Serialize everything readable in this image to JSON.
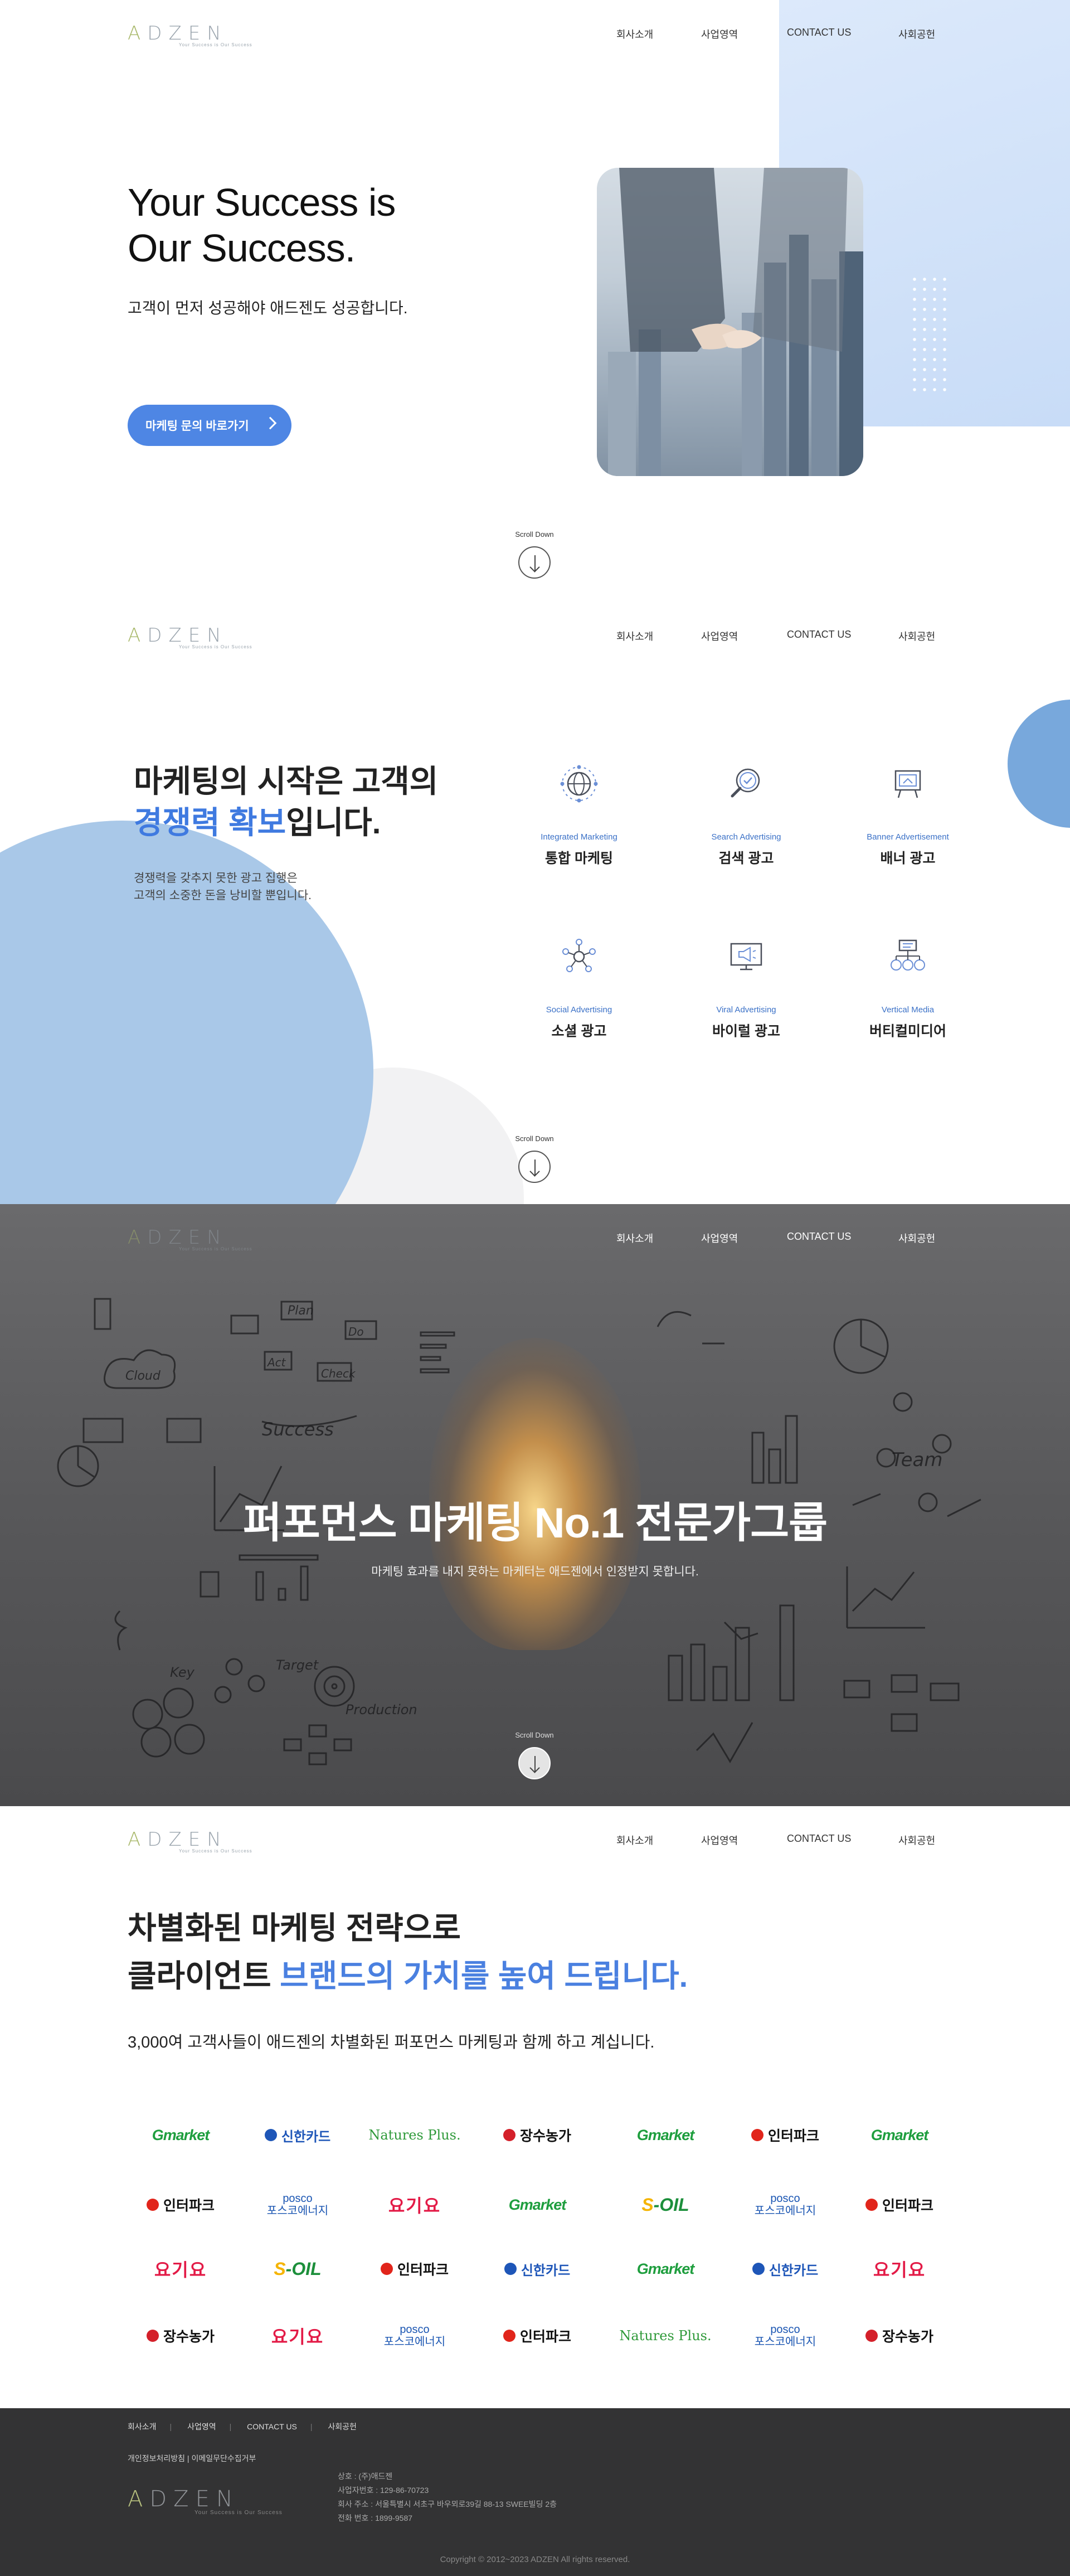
{
  "brand": {
    "logo": "ADZEN",
    "tagline": "Your Success is Our Success"
  },
  "nav": {
    "about": "회사소개",
    "business": "사업영역",
    "contact": "CONTACT US",
    "csr": "사회공헌"
  },
  "hero": {
    "title_line1": "Your Success is",
    "title_line2": "Our Success.",
    "subtitle": "고객이 먼저 성공해야 애드젠도 성공합니다.",
    "cta_label": "마케팅 문의 바로가기",
    "scroll_label": "Scroll Down"
  },
  "intro": {
    "title_line1": "마케팅의 시작은 고객의",
    "title_highlight": "경쟁력 확보",
    "title_suffix": "입니다.",
    "desc_line1": "경쟁력을 갖추지 못한 광고 집행은",
    "desc_line2": "고객의 소중한 돈을 낭비할 뿐입니다.",
    "scroll_label": "Scroll Down",
    "services": [
      {
        "en": "Integrated Marketing",
        "ko": "통합 마케팅",
        "icon": "globe-icon"
      },
      {
        "en": "Search Advertising",
        "ko": "검색 광고",
        "icon": "search-check-icon"
      },
      {
        "en": "Banner Advertisement",
        "ko": "배너 광고",
        "icon": "billboard-icon"
      },
      {
        "en": "Social Advertising",
        "ko": "소셜 광고",
        "icon": "network-icon"
      },
      {
        "en": "Viral Advertising",
        "ko": "바이럴 광고",
        "icon": "megaphone-screen-icon"
      },
      {
        "en": "Vertical Media",
        "ko": "버티컬미디어",
        "icon": "hierarchy-icon"
      }
    ]
  },
  "performance": {
    "title": "퍼포먼스 마케팅 No.1 전문가그룹",
    "subtitle": "마케팅 효과를 내지 못하는 마케터는 애드젠에서 인정받지 못합니다.",
    "scroll_label": "Scroll Down",
    "sketch_words": [
      "Plan",
      "Do",
      "Act",
      "Check",
      "Cloud",
      "Success",
      "Team",
      "Target",
      "Key",
      "Production"
    ]
  },
  "clients": {
    "title_line1": "차별화된 마케팅 전략으로",
    "title_line2_prefix": "클라이언트 ",
    "title_line2_highlight": "브랜드의 가치를 높여 드립니다.",
    "subtitle": "3,000여 고객사들이 애드젠의 차별화된 퍼포먼스 마케팅과 함께 하고 계십니다.",
    "logos": [
      [
        "Gmarket",
        "신한카드",
        "Natures Plus.",
        "장수농가",
        "Gmarket",
        "인터파크",
        "Gmarket"
      ],
      [
        "인터파크",
        "posco 포스코에너지",
        "요기요",
        "Gmarket",
        "S-OIL",
        "posco 포스코에너지",
        "인터파크"
      ],
      [
        "요기요",
        "S-OIL",
        "인터파크",
        "신한카드",
        "Gmarket",
        "신한카드",
        "요기요"
      ],
      [
        "장수농가",
        "요기요",
        "posco 포스코에너지",
        "인터파크",
        "Natures Plus.",
        "posco 포스코에너지",
        "장수농가"
      ]
    ]
  },
  "footer": {
    "links": [
      "회사소개",
      "사업영역",
      "CONTACT US",
      "사회공헌"
    ],
    "policy": "개인정보처리방침 | 이메일무단수집거부",
    "company": "상호 : (주)애드젠",
    "biz_no": "사업자번호 : 129-86-70723",
    "address": "회사 주소 : 서울특별시 서초구 바우뫼로39길 88-13 SWEE빌딩 2층",
    "phone": "전화 번호 : 1899-9587",
    "copyright": "Copyright © 2012~2023 ADZEN All rights reserved."
  },
  "colors": {
    "accent": "#4e86e4",
    "highlight": "#3f7ae0",
    "footer_bg": "#333334"
  }
}
